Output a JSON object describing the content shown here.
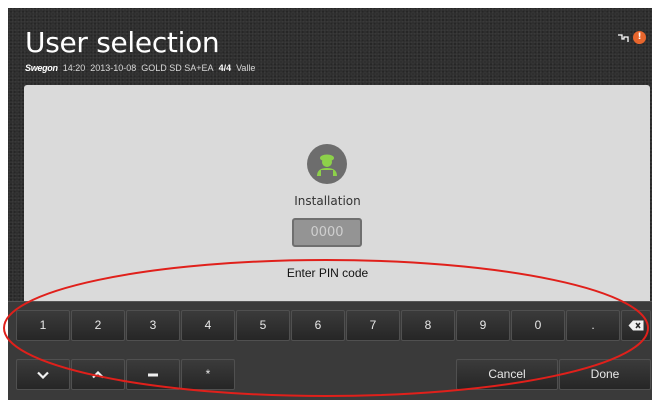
{
  "header": {
    "title": "User selection",
    "brand": "Swegon",
    "time": "14:20",
    "date": "2013-10-08",
    "model": "GOLD SD SA+EA",
    "fraction": "4/4",
    "user": "Valle",
    "icons": [
      "network-icon",
      "alarm-icon"
    ]
  },
  "user_card": {
    "icon": "installer-avatar-icon",
    "label": "Installation",
    "pin_placeholder": "0000",
    "pin_caption": "Enter PIN code"
  },
  "keyboard": {
    "row1": [
      "1",
      "2",
      "3",
      "4",
      "5",
      "6",
      "7",
      "8",
      "9",
      "0",
      "."
    ],
    "backspace_icon": "backspace-icon",
    "row2_icons": [
      "chevron-down-icon",
      "chevron-up-icon",
      "minus-icon"
    ],
    "row2_chars": [
      "*"
    ],
    "cancel_label": "Cancel",
    "done_label": "Done"
  },
  "annotation": {
    "color": "#e0201b"
  }
}
